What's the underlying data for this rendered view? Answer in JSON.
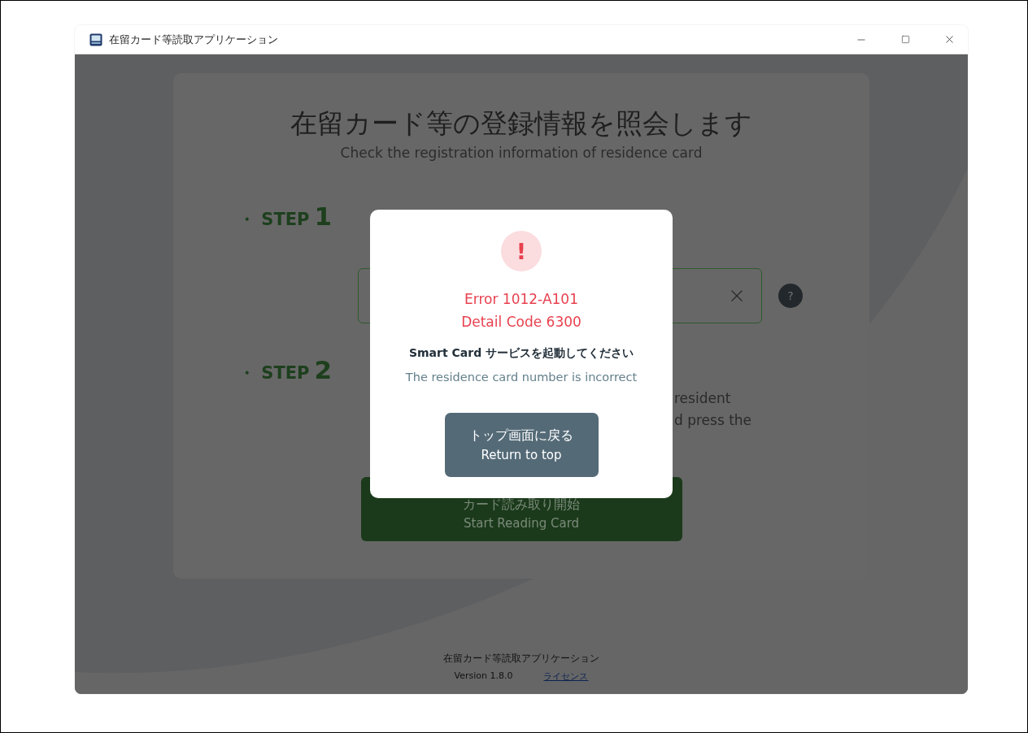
{
  "window": {
    "title": "在留カード等読取アプリケーション"
  },
  "main": {
    "heading": "在留カード等の登録情報を照会します",
    "subheading": "Check the registration information of residence card",
    "steps": [
      {
        "bullet": "・",
        "label": "STEP",
        "number": "1"
      },
      {
        "bullet": "・",
        "label": "STEP",
        "number": "2"
      }
    ],
    "card_number_field": {
      "help": "?"
    },
    "step2_text": [
      "resident",
      "d press the"
    ],
    "start_button": {
      "label_ja": "カード読み取り開始",
      "label_en": "Start Reading Card"
    }
  },
  "dialog": {
    "mark": "!",
    "error_code": "Error 1012-A101",
    "detail_code": "Detail Code 6300",
    "message_ja": "Smart Card サービスを起動してください",
    "message_en": "The residence card number is incorrect",
    "button": {
      "label_ja": "トップ画面に戻る",
      "label_en": "Return to top"
    }
  },
  "footer": {
    "app_name": "在留カード等読取アプリケーション",
    "version": "Version 1.8.0",
    "license_link": "ライセンス"
  }
}
